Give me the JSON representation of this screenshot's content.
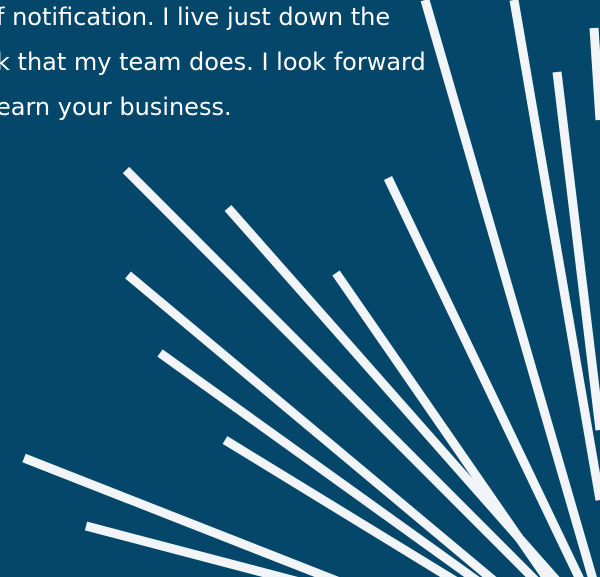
{
  "message": {
    "lines": [
      "f notification. I live just down the",
      "k that my team does. I look forward",
      "earn your business."
    ]
  },
  "decoration": {
    "background_color": "#04476b",
    "ray_color": "#f2f5f7",
    "ray_count": 13,
    "icon": "sunburst-rays"
  }
}
